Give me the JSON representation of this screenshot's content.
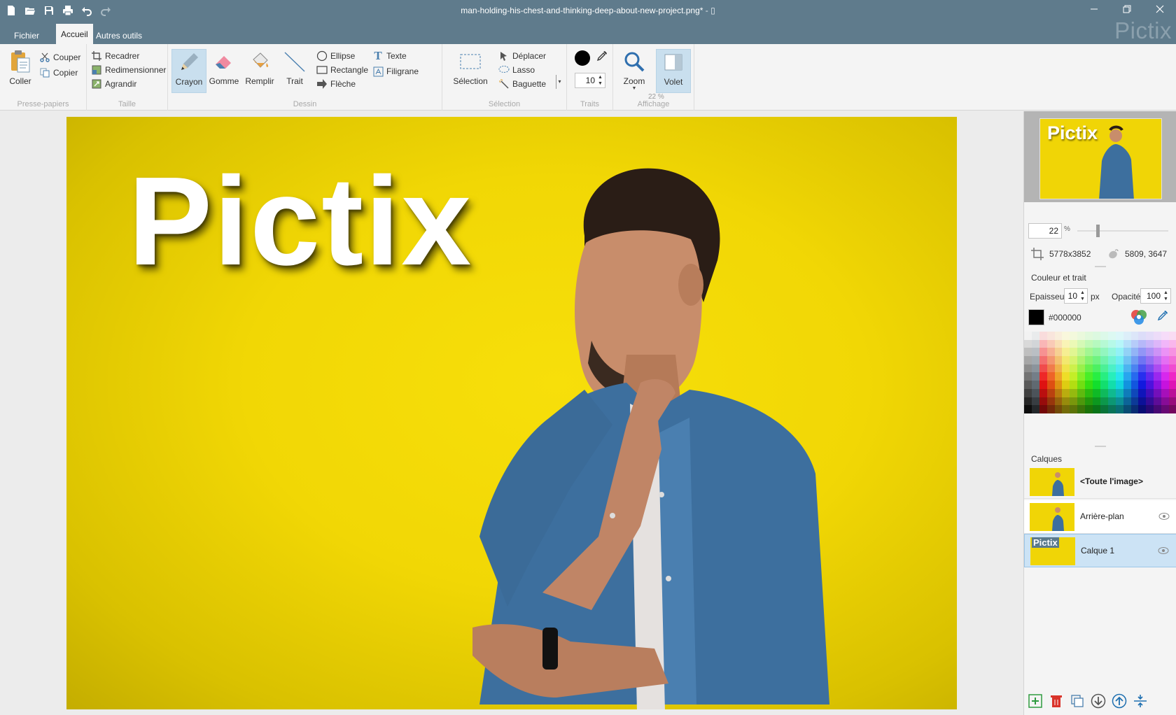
{
  "window": {
    "title": "man-holding-his-chest-and-thinking-deep-about-new-project.png*",
    "title_suffix": " - ▯"
  },
  "tabs": [
    {
      "label": "Fichier"
    },
    {
      "label": "Accueil"
    },
    {
      "label": "Autres outils"
    }
  ],
  "brand": "Pictix",
  "ribbon": {
    "clipboard": {
      "paste": "Coller",
      "cut": "Couper",
      "copy": "Copier",
      "group": "Presse-papiers"
    },
    "size": {
      "crop": "Recadrer",
      "resize": "Redimensionner",
      "enlarge": "Agrandir",
      "group": "Taille"
    },
    "draw": {
      "pencil": "Crayon",
      "eraser": "Gomme",
      "fill": "Remplir",
      "line": "Trait",
      "ellipse": "Ellipse",
      "rectangle": "Rectangle",
      "arrow": "Flèche",
      "text": "Texte",
      "watermark": "Filigrane",
      "group": "Dessin"
    },
    "selection": {
      "select": "Sélection",
      "move": "Déplacer",
      "lasso": "Lasso",
      "wand": "Baguette",
      "group": "Sélection"
    },
    "strokes": {
      "size": "10",
      "group": "Traits"
    },
    "view": {
      "zoom": "Zoom",
      "pane": "Volet",
      "group": "Affichage",
      "zoom_badge": "22 %"
    }
  },
  "canvas": {
    "overlay_text": "Pictix"
  },
  "panel": {
    "zoom_value": "22",
    "zoom_unit": "%",
    "image_size": "5778x3852",
    "cursor_pos": "5809, 3647",
    "color_section": "Couleur et trait",
    "thickness_label": "Epaisseur",
    "thickness_value": "10",
    "thickness_unit": "px",
    "opacity_label": "Opacité",
    "opacity_value": "100",
    "color_hex": "#000000",
    "thumb_text": "Pictix",
    "layers_title": "Calques",
    "layers": [
      {
        "name": "<Toute l'image>"
      },
      {
        "name": "Arrière-plan"
      },
      {
        "name": "Calque 1",
        "thumb_text": "Pictix"
      }
    ]
  },
  "colors": {
    "titlebar": "#5f7b8c",
    "canvas_bg": "#f1d705",
    "selected": "#c9dfee"
  }
}
